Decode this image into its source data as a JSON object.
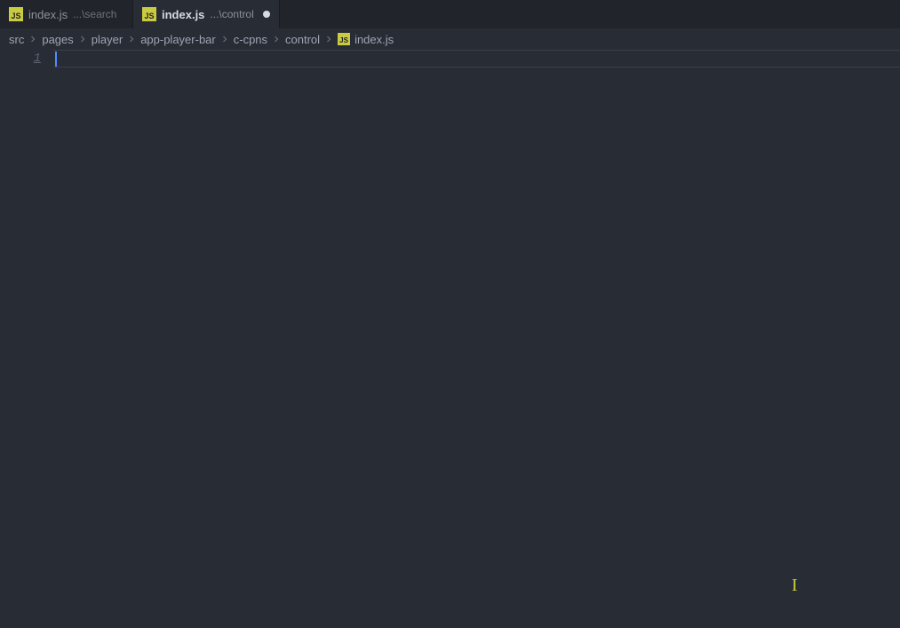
{
  "tabs": [
    {
      "icon": "JS",
      "label": "index.js",
      "path": "...\\search",
      "active": false,
      "dirty": false
    },
    {
      "icon": "JS",
      "label": "index.js",
      "path": "...\\control",
      "active": true,
      "dirty": true
    }
  ],
  "breadcrumbs": {
    "segments": [
      "src",
      "pages",
      "player",
      "app-player-bar",
      "c-cpns",
      "control"
    ],
    "file": {
      "icon": "JS",
      "name": "index.js"
    }
  },
  "editor": {
    "line_numbers": [
      "1"
    ],
    "content": ""
  }
}
